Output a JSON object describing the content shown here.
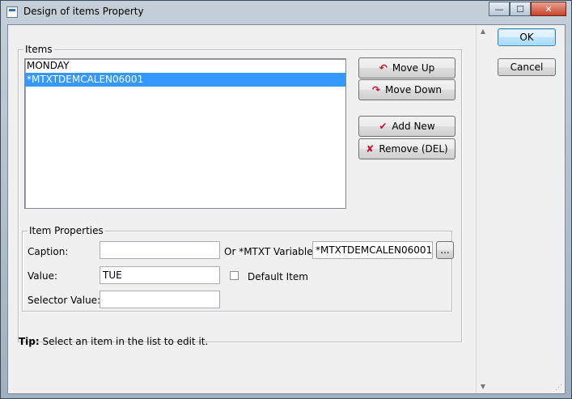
{
  "window": {
    "title": "Design of items Property",
    "icon": "app-icon"
  },
  "titlebar_buttons": {
    "minimize": "—",
    "maximize": "☐",
    "close": "✕"
  },
  "buttons": {
    "ok": "OK",
    "cancel": "Cancel",
    "move_up": "Move Up",
    "move_down": "Move Down",
    "add_new": "Add New",
    "remove": "Remove (DEL)",
    "browse": "..."
  },
  "items_group": {
    "label": "Items",
    "list": [
      {
        "text": "MONDAY",
        "selected": false
      },
      {
        "text": "*MTXTDEMCALEN06001",
        "selected": true
      }
    ]
  },
  "item_properties": {
    "label": "Item Properties",
    "caption_label": "Caption:",
    "caption_value": "",
    "mtxt_label": "Or *MTXT Variable:",
    "mtxt_value": "*MTXTDEMCALEN06001",
    "value_label": "Value:",
    "value_value": "TUE",
    "default_item_label": "Default Item",
    "default_item_checked": false,
    "selector_label": "Selector Value:",
    "selector_value": ""
  },
  "tip": {
    "bold": "Tip:",
    "text": " Select an item in the list to edit it."
  },
  "colors": {
    "selection": "#3399ff",
    "icon_red": "#c8102e"
  }
}
